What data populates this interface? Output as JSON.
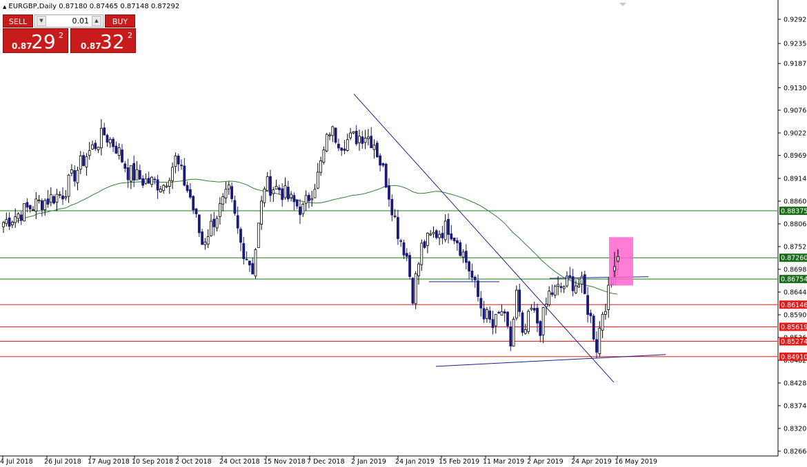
{
  "header": {
    "symbol_line": "EURGBP,Daily  0.87180 0.87465 0.87148 0.87292"
  },
  "trade_panel": {
    "sell_label": "SELL",
    "buy_label": "BUY",
    "lot_value": "0.01",
    "bid": {
      "prefix": "0.87",
      "big": "29",
      "sup": "2"
    },
    "ask": {
      "prefix": "0.87",
      "big": "32",
      "sup": "2"
    }
  },
  "colors": {
    "bull": "#000000",
    "bear": "#1a1a7a",
    "ma": "#2e7d32",
    "support": "#e51a1a",
    "resistance": "#1a7a1a",
    "trendline": "#1c1c8c",
    "highlight": "#ff66cc",
    "axis_green": "#1b6b1b",
    "axis_red": "#e51a1a"
  },
  "chart_data": {
    "type": "candlestick",
    "price_axis": {
      "ticks": [
        "0.92925",
        "0.92350",
        "0.91875",
        "0.91300",
        "0.90765",
        "0.90225",
        "0.89690",
        "0.89145",
        "0.88605",
        "0.88065",
        "0.87525",
        "0.86985",
        "0.86445",
        "0.85905",
        "0.85365",
        "0.84825",
        "0.84285",
        "0.83745",
        "0.83205",
        "0.82665"
      ],
      "range": [
        0.8262,
        0.9312
      ]
    },
    "time_axis": {
      "ticks": [
        "4 Jul 2018",
        "26 Jul 2018",
        "17 Aug 2018",
        "10 Sep 2018",
        "2 Oct 2018",
        "24 Oct 2018",
        "15 Nov 2018",
        "7 Dec 2018",
        "2 Jan 2019",
        "24 Jan 2019",
        "15 Feb 2019",
        "11 Mar 2019",
        "2 Apr 2019",
        "24 Apr 2019",
        "16 May 2019"
      ]
    },
    "horizontal_levels": [
      {
        "price": 0.88375,
        "label": "0.88375",
        "kind": "resistance"
      },
      {
        "price": 0.8726,
        "label": "0.87260",
        "kind": "resistance"
      },
      {
        "price": 0.86754,
        "label": "0.86754",
        "kind": "resistance"
      },
      {
        "price": 0.86146,
        "label": "0.86146",
        "kind": "support"
      },
      {
        "price": 0.85619,
        "label": "0.85619",
        "kind": "support"
      },
      {
        "price": 0.85274,
        "label": "0.85274",
        "kind": "support"
      },
      {
        "price": 0.8491,
        "label": "0.84910",
        "kind": "support"
      }
    ],
    "anchors": [
      [
        0,
        0.881
      ],
      [
        10,
        0.885
      ],
      [
        20,
        0.888
      ],
      [
        28,
        0.897
      ],
      [
        34,
        0.902
      ],
      [
        38,
        0.899
      ],
      [
        42,
        0.893
      ],
      [
        47,
        0.891
      ],
      [
        54,
        0.89
      ],
      [
        58,
        0.896
      ],
      [
        63,
        0.887
      ],
      [
        67,
        0.876
      ],
      [
        72,
        0.883
      ],
      [
        76,
        0.888
      ],
      [
        80,
        0.876
      ],
      [
        84,
        0.87
      ],
      [
        88,
        0.89
      ],
      [
        93,
        0.889
      ],
      [
        97,
        0.886
      ],
      [
        101,
        0.884
      ],
      [
        106,
        0.892
      ],
      [
        110,
        0.903
      ],
      [
        114,
        0.9
      ],
      [
        118,
        0.901
      ],
      [
        122,
        0.902
      ],
      [
        125,
        0.9
      ],
      [
        129,
        0.891
      ],
      [
        133,
        0.879
      ],
      [
        136,
        0.873
      ],
      [
        138,
        0.864
      ],
      [
        141,
        0.875
      ],
      [
        145,
        0.878
      ],
      [
        150,
        0.88
      ],
      [
        153,
        0.877
      ],
      [
        157,
        0.87
      ],
      [
        161,
        0.861
      ],
      [
        165,
        0.856
      ],
      [
        168,
        0.86
      ],
      [
        171,
        0.852
      ],
      [
        173,
        0.864
      ],
      [
        175,
        0.853
      ],
      [
        178,
        0.86
      ],
      [
        181,
        0.856
      ],
      [
        184,
        0.864
      ],
      [
        187,
        0.865
      ],
      [
        191,
        0.867
      ],
      [
        195,
        0.866
      ],
      [
        198,
        0.858
      ],
      [
        200,
        0.8515
      ],
      [
        202,
        0.86
      ],
      [
        205,
        0.866
      ],
      [
        206,
        0.872
      ],
      [
        207,
        0.8729
      ]
    ],
    "trendlines": [
      {
        "from": [
          "2 Jan 2019",
          0.9115
        ],
        "to": [
          "16 May 2019",
          0.843
        ]
      },
      {
        "from": [
          "15 Feb 2019",
          0.8468
        ],
        "to": [
          "16 May 2019",
          0.8496
        ]
      },
      {
        "from": [
          "15 Feb 2019",
          0.8669
        ],
        "to": [
          "11 Mar 2019",
          0.8669
        ]
      },
      {
        "from": [
          "2 Apr 2019",
          0.8677
        ],
        "to": [
          "16 May 2019",
          0.8681
        ]
      }
    ],
    "moving_average": "green line from 0.8815 (Jul 2018) rising to ~0.8910 (Jan 2019), then falling to ~0.8770 (May 2019)",
    "highlight_box": {
      "from_price": 0.866,
      "to_price": 0.8775,
      "near": "16 May 2019"
    }
  }
}
